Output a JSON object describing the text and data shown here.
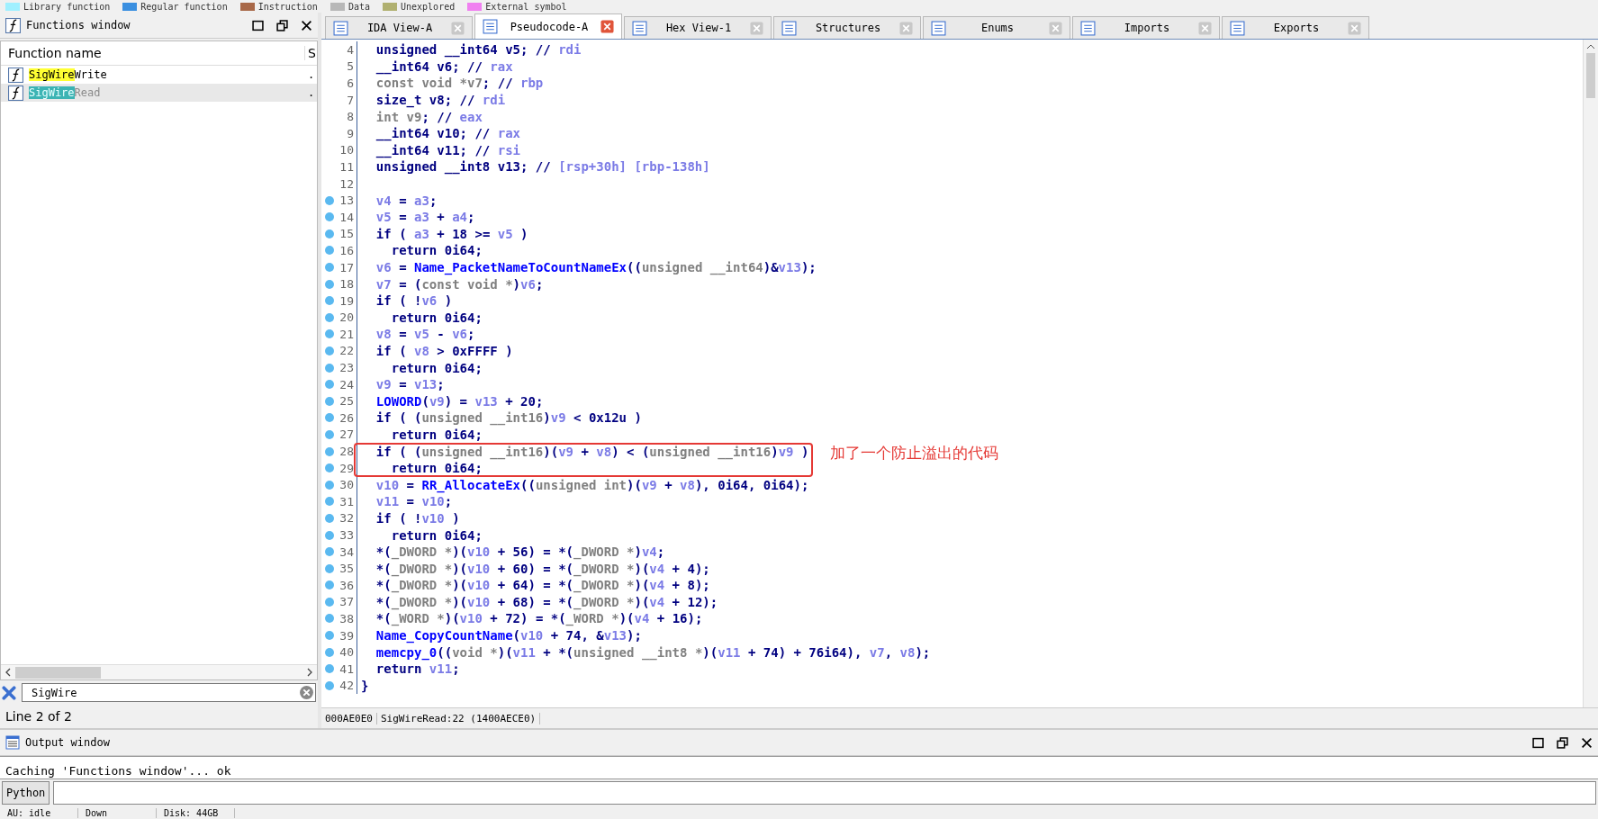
{
  "legend": [
    {
      "label": "Library function",
      "color": "#a0f0ff"
    },
    {
      "label": "Regular function",
      "color": "#3a8fe0"
    },
    {
      "label": "Instruction",
      "color": "#a86848"
    },
    {
      "label": "Data",
      "color": "#b8b8b8"
    },
    {
      "label": "Unexplored",
      "color": "#b0b070"
    },
    {
      "label": "External symbol",
      "color": "#f080f0"
    }
  ],
  "functions_window": {
    "title": "Functions window",
    "columns": [
      "Function name",
      "S"
    ],
    "rows": [
      {
        "match": "SigWire",
        "rest": "Write",
        "column_2": ".",
        "selected": false
      },
      {
        "match": "SigWire",
        "rest": "Read",
        "column_2": ".",
        "selected": true
      }
    ],
    "search": {
      "value": "SigWire"
    },
    "status": "Line 2 of 2"
  },
  "tabs": [
    {
      "label": "IDA View-A",
      "selected": false
    },
    {
      "label": "Pseudocode-A",
      "selected": true
    },
    {
      "label": "Hex View-1",
      "selected": false
    },
    {
      "label": "Structures",
      "selected": false
    },
    {
      "label": "Enums",
      "selected": false
    },
    {
      "label": "Imports",
      "selected": false
    },
    {
      "label": "Exports",
      "selected": false
    }
  ],
  "code_lines": [
    {
      "n": "4",
      "bp": false,
      "boxed": false,
      "tokens": [
        {
          "kind": "plain",
          "text": "  unsigned __int64 v5; // "
        },
        {
          "kind": "var",
          "text": "rdi"
        }
      ]
    },
    {
      "n": "5",
      "bp": false,
      "boxed": false,
      "tokens": [
        {
          "kind": "plain",
          "text": "  __int64 v6; // "
        },
        {
          "kind": "var",
          "text": "rax"
        }
      ]
    },
    {
      "n": "6",
      "bp": false,
      "boxed": false,
      "tokens": [
        {
          "kind": "type",
          "text": "  const void *v7"
        },
        {
          "kind": "plain",
          "text": "; // "
        },
        {
          "kind": "var",
          "text": "rbp"
        }
      ]
    },
    {
      "n": "7",
      "bp": false,
      "boxed": false,
      "tokens": [
        {
          "kind": "plain",
          "text": "  size_t v8; // "
        },
        {
          "kind": "var",
          "text": "rdi"
        }
      ]
    },
    {
      "n": "8",
      "bp": false,
      "boxed": false,
      "tokens": [
        {
          "kind": "type",
          "text": "  int v9"
        },
        {
          "kind": "plain",
          "text": "; // "
        },
        {
          "kind": "var",
          "text": "eax"
        }
      ]
    },
    {
      "n": "9",
      "bp": false,
      "boxed": false,
      "tokens": [
        {
          "kind": "plain",
          "text": "  __int64 v10; // "
        },
        {
          "kind": "var",
          "text": "rax"
        }
      ]
    },
    {
      "n": "10",
      "bp": false,
      "boxed": false,
      "tokens": [
        {
          "kind": "plain",
          "text": "  __int64 v11; // "
        },
        {
          "kind": "var",
          "text": "rsi"
        }
      ]
    },
    {
      "n": "11",
      "bp": false,
      "boxed": false,
      "tokens": [
        {
          "kind": "plain",
          "text": "  unsigned __int8 v13; // "
        },
        {
          "kind": "var",
          "text": "[rsp+30h] [rbp-138h]"
        }
      ]
    },
    {
      "n": "12",
      "bp": false,
      "boxed": false
    },
    {
      "n": "13",
      "bp": true,
      "boxed": false,
      "tokens": [
        {
          "kind": "var",
          "text": "  v4"
        },
        {
          "kind": "plain",
          "text": " = "
        },
        {
          "kind": "var",
          "text": "a3"
        },
        {
          "kind": "plain",
          "text": ";"
        }
      ]
    },
    {
      "n": "14",
      "bp": true,
      "boxed": false,
      "tokens": [
        {
          "kind": "var",
          "text": "  v5"
        },
        {
          "kind": "plain",
          "text": " = "
        },
        {
          "kind": "var",
          "text": "a3"
        },
        {
          "kind": "plain",
          "text": " + "
        },
        {
          "kind": "var",
          "text": "a4"
        },
        {
          "kind": "plain",
          "text": ";"
        }
      ]
    },
    {
      "n": "15",
      "bp": true,
      "boxed": false,
      "tokens": [
        {
          "kind": "plain",
          "text": "  if ( "
        },
        {
          "kind": "var",
          "text": "a3"
        },
        {
          "kind": "plain",
          "text": " + 18 >= "
        },
        {
          "kind": "var",
          "text": "v5"
        },
        {
          "kind": "plain",
          "text": " )"
        }
      ]
    },
    {
      "n": "16",
      "bp": true,
      "boxed": false,
      "tokens": [
        {
          "kind": "plain",
          "text": "    return 0i64;"
        }
      ]
    },
    {
      "n": "17",
      "bp": true,
      "boxed": false,
      "tokens": [
        {
          "kind": "var",
          "text": "  v6"
        },
        {
          "kind": "plain",
          "text": " = "
        },
        {
          "kind": "func",
          "text": "Name_PacketNameToCountNameEx"
        },
        {
          "kind": "plain",
          "text": "(("
        },
        {
          "kind": "type",
          "text": "unsigned __int64"
        },
        {
          "kind": "plain",
          "text": ")&"
        },
        {
          "kind": "var",
          "text": "v13"
        },
        {
          "kind": "plain",
          "text": ");"
        }
      ]
    },
    {
      "n": "18",
      "bp": true,
      "boxed": false,
      "tokens": [
        {
          "kind": "var",
          "text": "  v7"
        },
        {
          "kind": "plain",
          "text": " = ("
        },
        {
          "kind": "type",
          "text": "const void *"
        },
        {
          "kind": "plain",
          "text": ")"
        },
        {
          "kind": "var",
          "text": "v6"
        },
        {
          "kind": "plain",
          "text": ";"
        }
      ]
    },
    {
      "n": "19",
      "bp": true,
      "boxed": false,
      "tokens": [
        {
          "kind": "plain",
          "text": "  if ( !"
        },
        {
          "kind": "var",
          "text": "v6"
        },
        {
          "kind": "plain",
          "text": " )"
        }
      ]
    },
    {
      "n": "20",
      "bp": true,
      "boxed": false,
      "tokens": [
        {
          "kind": "plain",
          "text": "    return 0i64;"
        }
      ]
    },
    {
      "n": "21",
      "bp": true,
      "boxed": false,
      "tokens": [
        {
          "kind": "var",
          "text": "  v8"
        },
        {
          "kind": "plain",
          "text": " = "
        },
        {
          "kind": "var",
          "text": "v5"
        },
        {
          "kind": "plain",
          "text": " - "
        },
        {
          "kind": "var",
          "text": "v6"
        },
        {
          "kind": "plain",
          "text": ";"
        }
      ]
    },
    {
      "n": "22",
      "bp": true,
      "boxed": false,
      "tokens": [
        {
          "kind": "plain",
          "text": "  if ( "
        },
        {
          "kind": "var",
          "text": "v8"
        },
        {
          "kind": "plain",
          "text": " > 0xFFFF )"
        }
      ]
    },
    {
      "n": "23",
      "bp": true,
      "boxed": false,
      "tokens": [
        {
          "kind": "plain",
          "text": "    return 0i64;"
        }
      ]
    },
    {
      "n": "24",
      "bp": true,
      "boxed": false,
      "tokens": [
        {
          "kind": "var",
          "text": "  v9"
        },
        {
          "kind": "plain",
          "text": " = "
        },
        {
          "kind": "var",
          "text": "v13"
        },
        {
          "kind": "plain",
          "text": ";"
        }
      ]
    },
    {
      "n": "25",
      "bp": true,
      "boxed": false,
      "tokens": [
        {
          "kind": "func",
          "text": "  LOWORD"
        },
        {
          "kind": "plain",
          "text": "("
        },
        {
          "kind": "var",
          "text": "v9"
        },
        {
          "kind": "plain",
          "text": ") = "
        },
        {
          "kind": "var",
          "text": "v13"
        },
        {
          "kind": "plain",
          "text": " + 20;"
        }
      ]
    },
    {
      "n": "26",
      "bp": true,
      "boxed": false,
      "tokens": [
        {
          "kind": "plain",
          "text": "  if ( ("
        },
        {
          "kind": "type",
          "text": "unsigned __int16"
        },
        {
          "kind": "plain",
          "text": ")"
        },
        {
          "kind": "var",
          "text": "v9"
        },
        {
          "kind": "plain",
          "text": " < 0x12u )"
        }
      ]
    },
    {
      "n": "27",
      "bp": true,
      "boxed": false,
      "tokens": [
        {
          "kind": "plain",
          "text": "    return 0i64;"
        }
      ]
    },
    {
      "n": "28",
      "bp": true,
      "boxed": true,
      "tokens": [
        {
          "kind": "plain",
          "text": "  if ( ("
        },
        {
          "kind": "type",
          "text": "unsigned __int16"
        },
        {
          "kind": "plain",
          "text": ")("
        },
        {
          "kind": "var",
          "text": "v9"
        },
        {
          "kind": "plain",
          "text": " + "
        },
        {
          "kind": "var",
          "text": "v8"
        },
        {
          "kind": "plain",
          "text": ") < ("
        },
        {
          "kind": "type",
          "text": "unsigned __int16"
        },
        {
          "kind": "plain",
          "text": ")"
        },
        {
          "kind": "var",
          "text": "v9"
        },
        {
          "kind": "plain",
          "text": " )"
        }
      ]
    },
    {
      "n": "29",
      "bp": true,
      "boxed": true,
      "tokens": [
        {
          "kind": "plain",
          "text": "    return 0i64;"
        }
      ]
    },
    {
      "n": "30",
      "bp": true,
      "boxed": false,
      "tokens": [
        {
          "kind": "var",
          "text": "  v10"
        },
        {
          "kind": "plain",
          "text": " = "
        },
        {
          "kind": "func",
          "text": "RR_AllocateEx"
        },
        {
          "kind": "plain",
          "text": "(("
        },
        {
          "kind": "type",
          "text": "unsigned int"
        },
        {
          "kind": "plain",
          "text": ")("
        },
        {
          "kind": "var",
          "text": "v9"
        },
        {
          "kind": "plain",
          "text": " + "
        },
        {
          "kind": "var",
          "text": "v8"
        },
        {
          "kind": "plain",
          "text": "), 0i64, 0i64);"
        }
      ]
    },
    {
      "n": "31",
      "bp": true,
      "boxed": false,
      "tokens": [
        {
          "kind": "var",
          "text": "  v11"
        },
        {
          "kind": "plain",
          "text": " = "
        },
        {
          "kind": "var",
          "text": "v10"
        },
        {
          "kind": "plain",
          "text": ";"
        }
      ]
    },
    {
      "n": "32",
      "bp": true,
      "boxed": false,
      "tokens": [
        {
          "kind": "plain",
          "text": "  if ( !"
        },
        {
          "kind": "var",
          "text": "v10"
        },
        {
          "kind": "plain",
          "text": " )"
        }
      ]
    },
    {
      "n": "33",
      "bp": true,
      "boxed": false,
      "tokens": [
        {
          "kind": "plain",
          "text": "    return 0i64;"
        }
      ]
    },
    {
      "n": "34",
      "bp": true,
      "boxed": false,
      "tokens": [
        {
          "kind": "plain",
          "text": "  *("
        },
        {
          "kind": "type",
          "text": "_DWORD *"
        },
        {
          "kind": "plain",
          "text": ")("
        },
        {
          "kind": "var",
          "text": "v10"
        },
        {
          "kind": "plain",
          "text": " + 56) = *("
        },
        {
          "kind": "type",
          "text": "_DWORD *"
        },
        {
          "kind": "plain",
          "text": ")"
        },
        {
          "kind": "var",
          "text": "v4"
        },
        {
          "kind": "plain",
          "text": ";"
        }
      ]
    },
    {
      "n": "35",
      "bp": true,
      "boxed": false,
      "tokens": [
        {
          "kind": "plain",
          "text": "  *("
        },
        {
          "kind": "type",
          "text": "_DWORD *"
        },
        {
          "kind": "plain",
          "text": ")("
        },
        {
          "kind": "var",
          "text": "v10"
        },
        {
          "kind": "plain",
          "text": " + 60) = *("
        },
        {
          "kind": "type",
          "text": "_DWORD *"
        },
        {
          "kind": "plain",
          "text": ")("
        },
        {
          "kind": "var",
          "text": "v4"
        },
        {
          "kind": "plain",
          "text": " + 4);"
        }
      ]
    },
    {
      "n": "36",
      "bp": true,
      "boxed": false,
      "tokens": [
        {
          "kind": "plain",
          "text": "  *("
        },
        {
          "kind": "type",
          "text": "_DWORD *"
        },
        {
          "kind": "plain",
          "text": ")("
        },
        {
          "kind": "var",
          "text": "v10"
        },
        {
          "kind": "plain",
          "text": " + 64) = *("
        },
        {
          "kind": "type",
          "text": "_DWORD *"
        },
        {
          "kind": "plain",
          "text": ")("
        },
        {
          "kind": "var",
          "text": "v4"
        },
        {
          "kind": "plain",
          "text": " + 8);"
        }
      ]
    },
    {
      "n": "37",
      "bp": true,
      "boxed": false,
      "tokens": [
        {
          "kind": "plain",
          "text": "  *("
        },
        {
          "kind": "type",
          "text": "_DWORD *"
        },
        {
          "kind": "plain",
          "text": ")("
        },
        {
          "kind": "var",
          "text": "v10"
        },
        {
          "kind": "plain",
          "text": " + 68) = *("
        },
        {
          "kind": "type",
          "text": "_DWORD *"
        },
        {
          "kind": "plain",
          "text": ")("
        },
        {
          "kind": "var",
          "text": "v4"
        },
        {
          "kind": "plain",
          "text": " + 12);"
        }
      ]
    },
    {
      "n": "38",
      "bp": true,
      "boxed": false,
      "tokens": [
        {
          "kind": "plain",
          "text": "  *("
        },
        {
          "kind": "type",
          "text": "_WORD *"
        },
        {
          "kind": "plain",
          "text": ")("
        },
        {
          "kind": "var",
          "text": "v10"
        },
        {
          "kind": "plain",
          "text": " + 72) = *("
        },
        {
          "kind": "type",
          "text": "_WORD *"
        },
        {
          "kind": "plain",
          "text": ")("
        },
        {
          "kind": "var",
          "text": "v4"
        },
        {
          "kind": "plain",
          "text": " + 16);"
        }
      ]
    },
    {
      "n": "39",
      "bp": true,
      "boxed": false,
      "tokens": [
        {
          "kind": "func",
          "text": "  Name_CopyCountName"
        },
        {
          "kind": "plain",
          "text": "("
        },
        {
          "kind": "var",
          "text": "v10"
        },
        {
          "kind": "plain",
          "text": " + 74, &"
        },
        {
          "kind": "var",
          "text": "v13"
        },
        {
          "kind": "plain",
          "text": ");"
        }
      ]
    },
    {
      "n": "40",
      "bp": true,
      "boxed": false,
      "tokens": [
        {
          "kind": "func",
          "text": "  memcpy_0"
        },
        {
          "kind": "plain",
          "text": "(("
        },
        {
          "kind": "type",
          "text": "void *"
        },
        {
          "kind": "plain",
          "text": ")("
        },
        {
          "kind": "var",
          "text": "v11"
        },
        {
          "kind": "plain",
          "text": " + *("
        },
        {
          "kind": "type",
          "text": "unsigned __int8 *"
        },
        {
          "kind": "plain",
          "text": ")("
        },
        {
          "kind": "var",
          "text": "v11"
        },
        {
          "kind": "plain",
          "text": " + 74) + 76i64), "
        },
        {
          "kind": "var",
          "text": "v7"
        },
        {
          "kind": "plain",
          "text": ", "
        },
        {
          "kind": "var",
          "text": "v8"
        },
        {
          "kind": "plain",
          "text": ");"
        }
      ]
    },
    {
      "n": "41",
      "bp": true,
      "boxed": false,
      "tokens": [
        {
          "kind": "plain",
          "text": "  return "
        },
        {
          "kind": "var",
          "text": "v11"
        },
        {
          "kind": "plain",
          "text": ";"
        }
      ]
    },
    {
      "n": "42",
      "bp": true,
      "boxed": false,
      "tokens": [
        {
          "kind": "plain",
          "text": "}"
        }
      ]
    }
  ],
  "annotation": "加了一个防止溢出的代码",
  "code_status": [
    "000AE0E0",
    "SigWireRead:22 (1400AECE0)"
  ],
  "output_window": {
    "title": "Output window",
    "lines": [
      "Caching 'Functions window'... ok"
    ],
    "button": "Python"
  },
  "status_bar": [
    "AU:  idle",
    "Down",
    "Disk: 44GB"
  ]
}
